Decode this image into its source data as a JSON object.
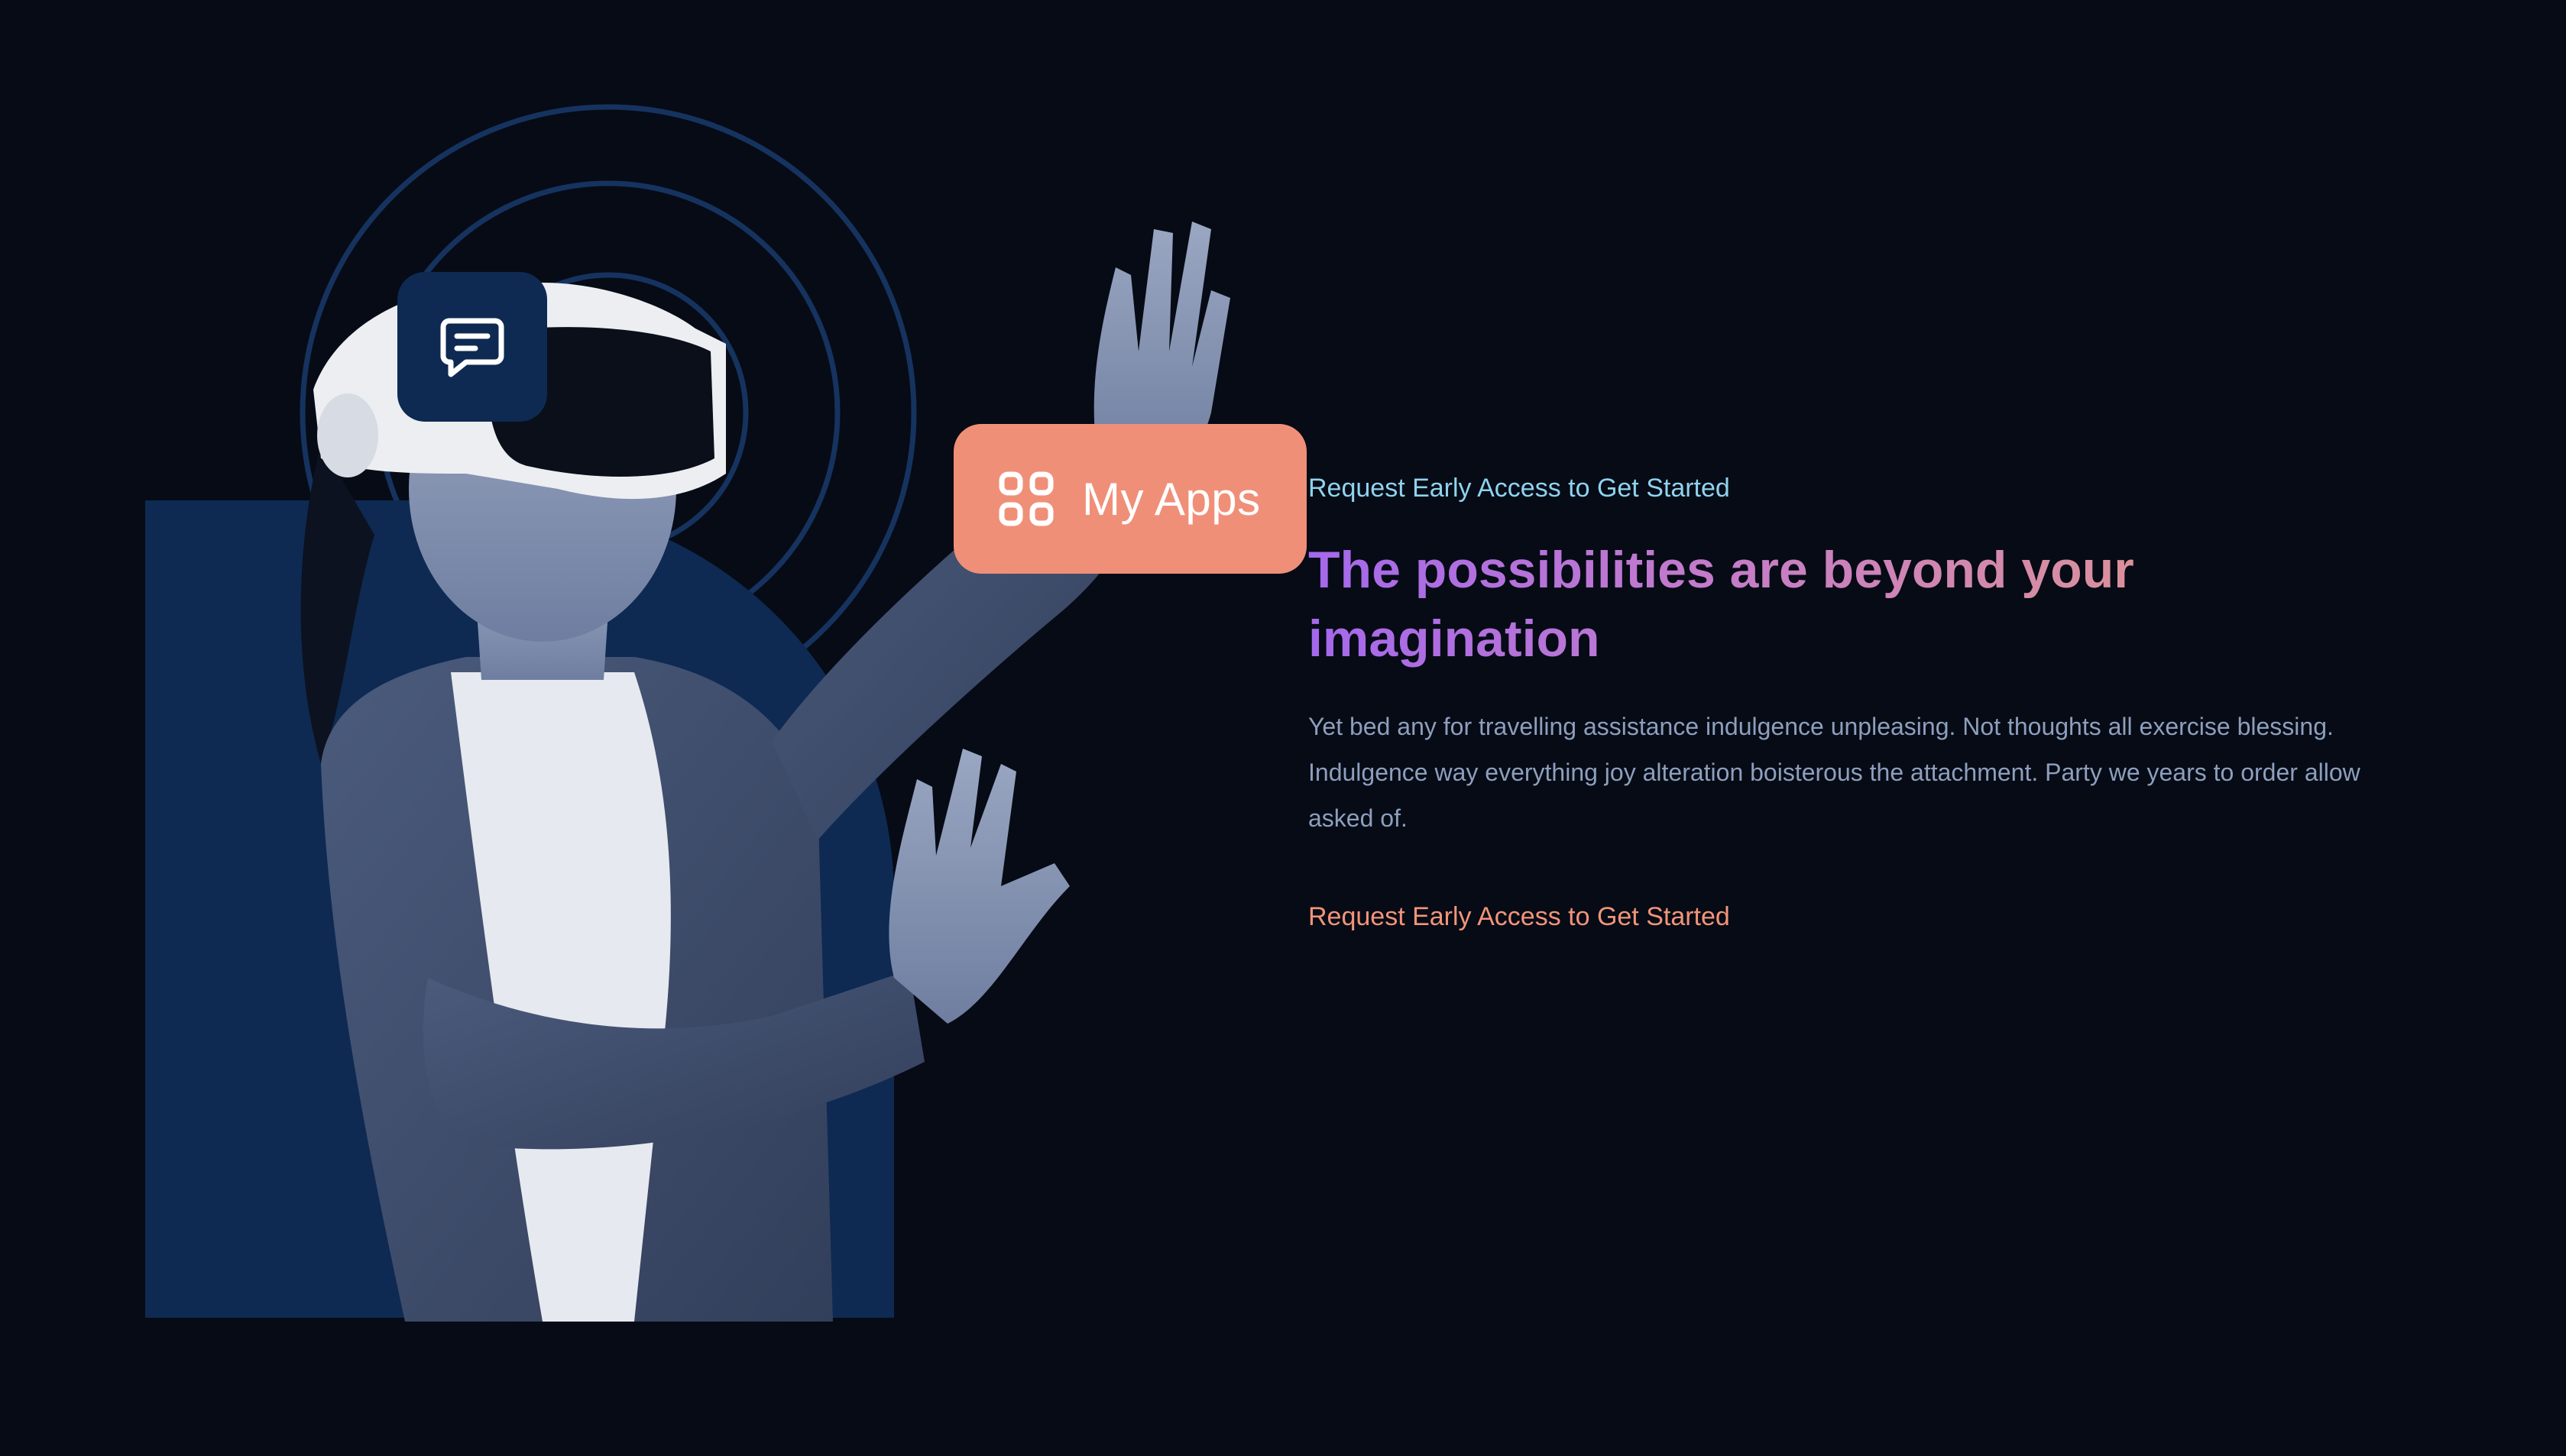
{
  "hero": {
    "apps_label": "My Apps",
    "icons": {
      "chat": "chat-bubble-icon",
      "apps": "apps-grid-icon"
    },
    "image_description": "woman-wearing-vr-headset"
  },
  "content": {
    "eyebrow": "Request Early Access to Get Started",
    "headline": "The possibilities are beyond your imagination",
    "body": "Yet bed any for travelling assistance indulgence unpleasing. Not thoughts all exercise blessing. Indulgence way everything joy alteration boisterous the attachment. Party we years to order allow asked of.",
    "cta": "Request Early Access to Get Started"
  },
  "colors": {
    "background": "#060b16",
    "panel": "#0e2a52",
    "accent_coral": "#f08f78",
    "eyebrow": "#8fd3ee",
    "headline_start": "#a468ec",
    "headline_end": "#e0968f",
    "body_text": "#8d9fbd"
  }
}
